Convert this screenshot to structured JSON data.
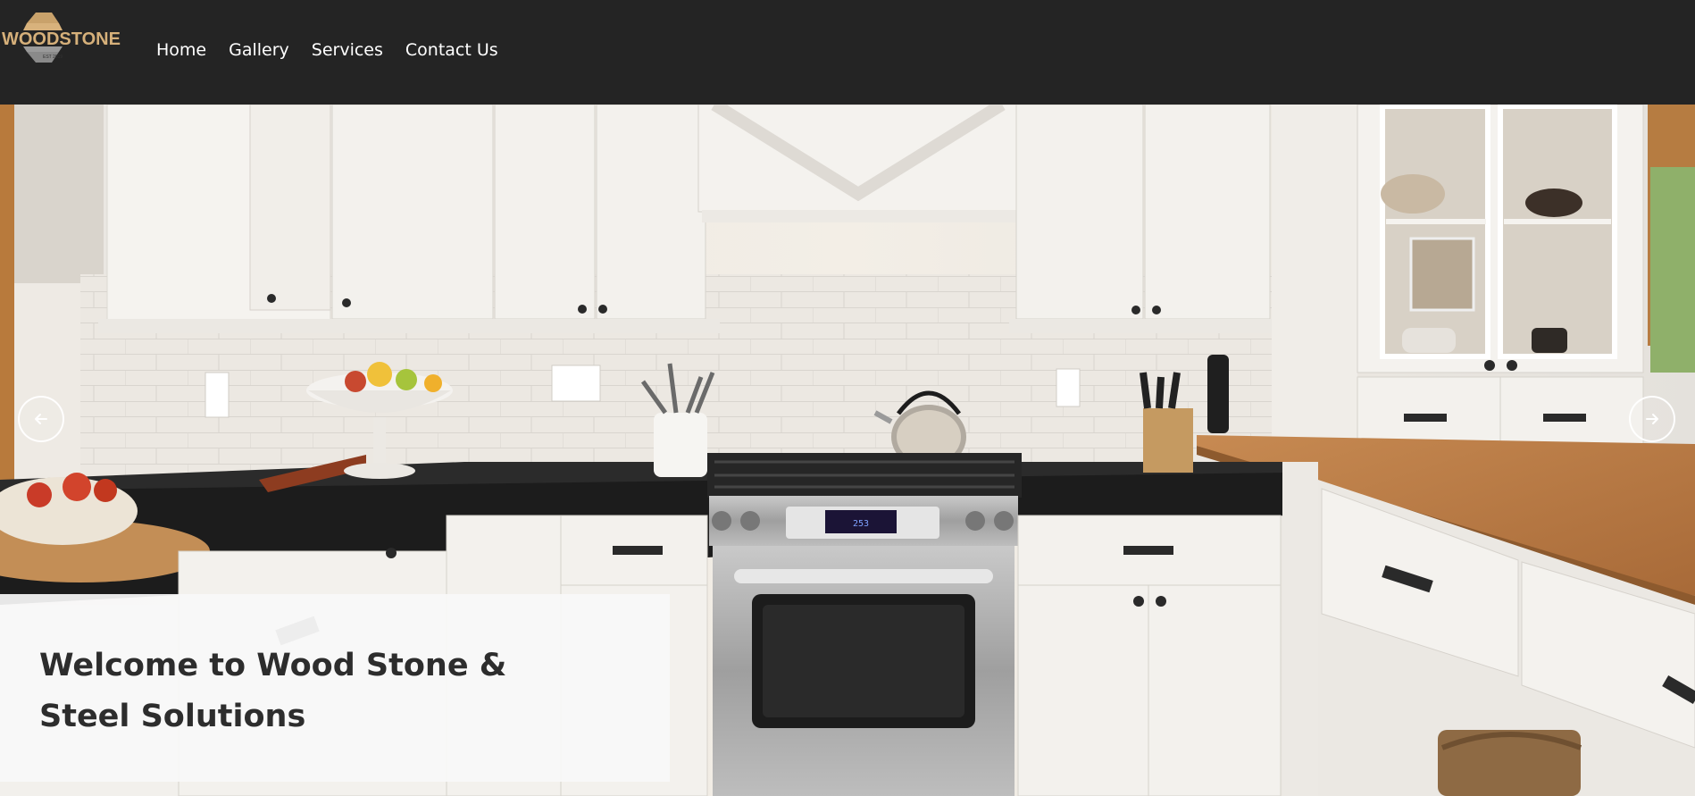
{
  "brand": {
    "name": "WOODSTONE",
    "tagline": "EST 2019"
  },
  "nav": {
    "items": [
      {
        "label": "Home"
      },
      {
        "label": "Gallery"
      },
      {
        "label": "Services"
      },
      {
        "label": "Contact Us"
      }
    ]
  },
  "hero": {
    "heading": "Welcome to Wood Stone & Steel Solutions",
    "stove_display": "253",
    "prev_icon": "arrow-left-icon",
    "next_icon": "arrow-right-icon"
  },
  "colors": {
    "header_bg": "#242424",
    "nav_text": "#ffffff",
    "caption_bg": "#f8f8f8",
    "heading_text": "#2d2d2d",
    "cabinet_white": "#f4f2ee",
    "countertop_black": "#1c1c1c",
    "butcher_block": "#b97a45"
  }
}
